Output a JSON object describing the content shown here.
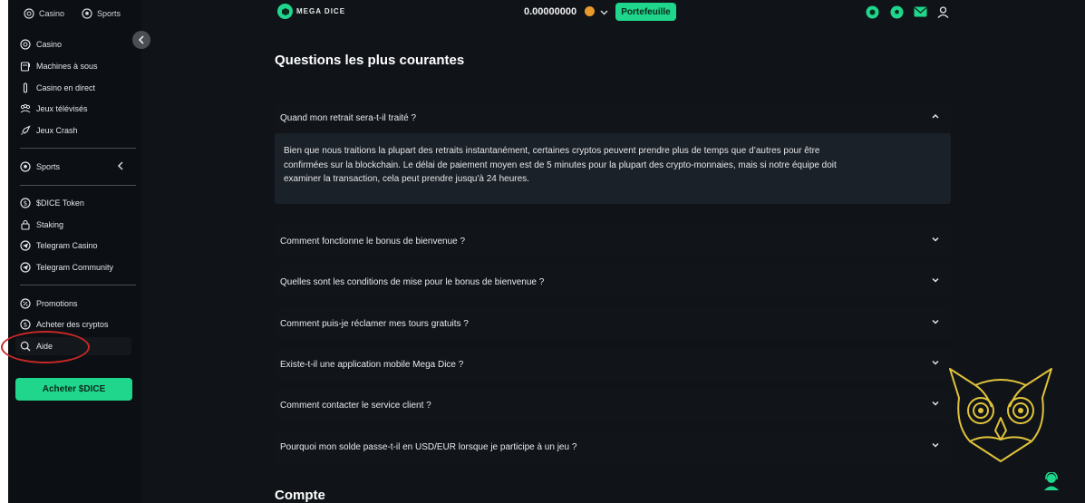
{
  "sidebar": {
    "tabs": [
      {
        "label": "Casino",
        "icon": "casino-chip-icon"
      },
      {
        "label": "Sports",
        "icon": "soccer-ball-icon"
      }
    ],
    "items": [
      {
        "label": "Casino",
        "icon": "casino-chip-icon"
      },
      {
        "label": "Machines à sous",
        "icon": "slot-machine-icon"
      },
      {
        "label": "Casino en direct",
        "icon": "live-casino-icon"
      },
      {
        "label": "Jeux télévisés",
        "icon": "game-show-icon"
      },
      {
        "label": "Jeux Crash",
        "icon": "rocket-icon"
      },
      {
        "label": "Sports",
        "icon": "soccer-ball-icon"
      },
      {
        "label": "$DICE Token",
        "icon": "dice-token-icon"
      },
      {
        "label": "Staking",
        "icon": "lock-icon"
      },
      {
        "label": "Telegram Casino",
        "icon": "telegram-icon"
      },
      {
        "label": "Telegram Community",
        "icon": "telegram-icon"
      },
      {
        "label": "Promotions",
        "icon": "promotions-icon"
      },
      {
        "label": "Acheter des cryptos",
        "icon": "dollar-coin-icon"
      },
      {
        "label": "Aide",
        "icon": "search-icon"
      }
    ],
    "buy_button": "Acheter $DICE"
  },
  "header": {
    "logo_text": "MEGA DICE",
    "balance": "0.00000000",
    "wallet_button": "Portefeuille"
  },
  "faq": {
    "title": "Questions les plus courantes",
    "questions": [
      "Quand mon retrait sera-t-il traité ?",
      "Comment fonctionne le bonus de bienvenue ?",
      "Quelles sont les conditions de mise pour le bonus de bienvenue ?",
      "Comment puis-je réclamer mes tours gratuits ?",
      "Existe-t-il une application mobile Mega Dice ?",
      "Comment contacter le service client ?",
      "Pourquoi mon solde passe-t-il en USD/EUR lorsque je participe à un jeu ?"
    ],
    "answer_line1": "Bien que nous traitions la plupart des retraits instantanément, certaines cryptos peuvent prendre plus de temps que d’autres pour être",
    "answer_line2": "confirmées sur la blockchain. Le délai de paiement moyen est de 5 minutes pour la plupart des crypto-monnaies, mais si notre équipe doit",
    "answer_line3": "examiner la transaction, cela peut prendre jusqu'à 24 heures.",
    "next_section_title": "Compte"
  },
  "colors": {
    "accent": "#1fd68c",
    "background": "#101419",
    "sidebar": "#0c0f13",
    "annotation": "#c62828",
    "owl": "#e0c23a"
  }
}
